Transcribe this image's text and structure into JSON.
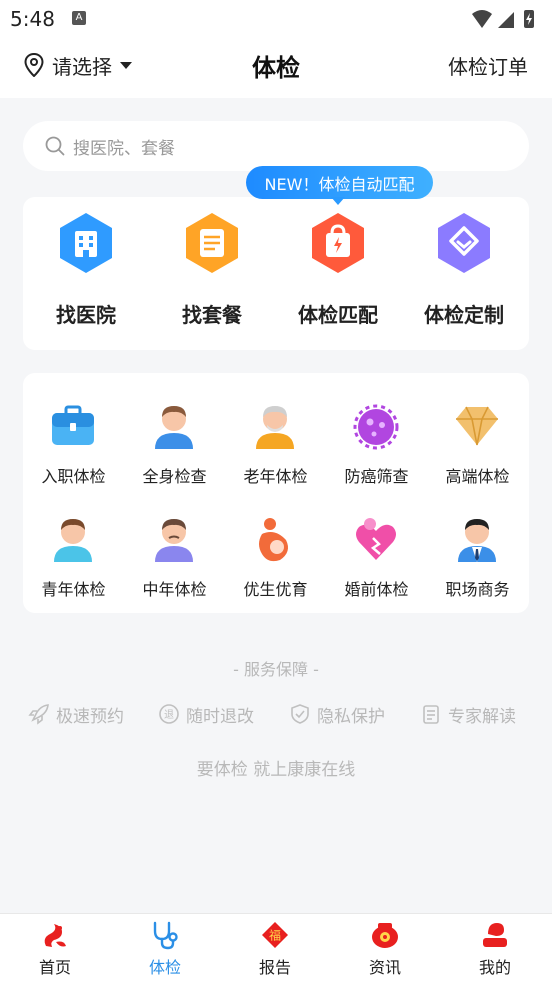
{
  "status_bar": {
    "time": "5:48",
    "badge": "A"
  },
  "header": {
    "location": "请选择",
    "title": "体检",
    "orders": "体检订单"
  },
  "search": {
    "placeholder": "搜医院、套餐"
  },
  "bubble": "NEW！体检自动匹配",
  "features": [
    {
      "label": "找医院",
      "icon": "hospital-icon",
      "color": "#2f9bff"
    },
    {
      "label": "找套餐",
      "icon": "package-icon",
      "color": "#ffa426"
    },
    {
      "label": "体检匹配",
      "icon": "match-icon",
      "color": "#ff5a3b"
    },
    {
      "label": "体检定制",
      "icon": "custom-icon",
      "color": "#8b7bff"
    }
  ],
  "categories": [
    {
      "label": "入职体检",
      "icon": "briefcase-icon"
    },
    {
      "label": "全身检查",
      "icon": "adult-avatar-icon"
    },
    {
      "label": "老年体检",
      "icon": "elder-avatar-icon"
    },
    {
      "label": "防癌筛查",
      "icon": "cell-icon"
    },
    {
      "label": "高端体检",
      "icon": "diamond-icon"
    },
    {
      "label": "青年体检",
      "icon": "youth-avatar-icon"
    },
    {
      "label": "中年体检",
      "icon": "middle-age-avatar-icon"
    },
    {
      "label": "优生优育",
      "icon": "maternity-icon"
    },
    {
      "label": "婚前体检",
      "icon": "couple-heart-icon"
    },
    {
      "label": "职场商务",
      "icon": "business-avatar-icon"
    }
  ],
  "services": {
    "title": "- 服务保障 -",
    "items": [
      {
        "label": "极速预约",
        "icon": "rocket-icon"
      },
      {
        "label": "随时退改",
        "icon": "refund-icon"
      },
      {
        "label": "隐私保护",
        "icon": "shield-icon"
      },
      {
        "label": "专家解读",
        "icon": "document-icon"
      }
    ]
  },
  "slogan": "要体检 就上康康在线",
  "tabs": [
    {
      "label": "首页",
      "icon": "home-logo-icon",
      "active": false
    },
    {
      "label": "体检",
      "icon": "stethoscope-icon",
      "active": true
    },
    {
      "label": "报告",
      "icon": "fu-report-icon",
      "active": false
    },
    {
      "label": "资讯",
      "icon": "news-icon",
      "active": false
    },
    {
      "label": "我的",
      "icon": "profile-icon",
      "active": false
    }
  ],
  "colors": {
    "accent": "#2b8fe6",
    "brand_red": "#e8201f"
  }
}
